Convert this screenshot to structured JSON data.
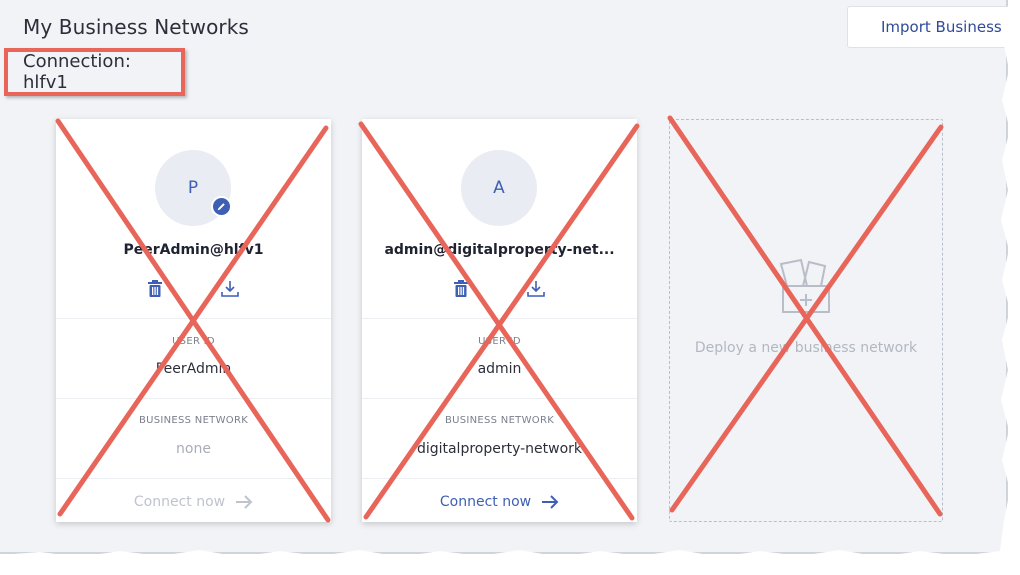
{
  "page": {
    "title": "My Business Networks",
    "import_button": "Import Business N",
    "connection_label": "Connection: hlfv1"
  },
  "cards": [
    {
      "avatar_letter": "P",
      "name": "PeerAdmin@hlfv1",
      "user_id_label": "USER ID",
      "user_id": "PeerAdmin",
      "network_label": "BUSINESS NETWORK",
      "network": "none",
      "connect_label": "Connect now",
      "connect_enabled": false,
      "has_edit_badge": true
    },
    {
      "avatar_letter": "A",
      "name": "admin@digitalproperty-net...",
      "user_id_label": "USER ID",
      "user_id": "admin",
      "network_label": "BUSINESS NETWORK",
      "network": "digitalproperty-network",
      "connect_label": "Connect now",
      "connect_enabled": true,
      "has_edit_badge": false
    }
  ],
  "deploy": {
    "label": "Deploy a new business network"
  },
  "colors": {
    "accent": "#3f5fb5",
    "annotation_red": "#e8655a",
    "background": "#f1f3f7"
  },
  "icons": [
    "trash-icon",
    "export-icon",
    "edit-icon",
    "arrow-right-icon",
    "deploy-network-icon"
  ]
}
